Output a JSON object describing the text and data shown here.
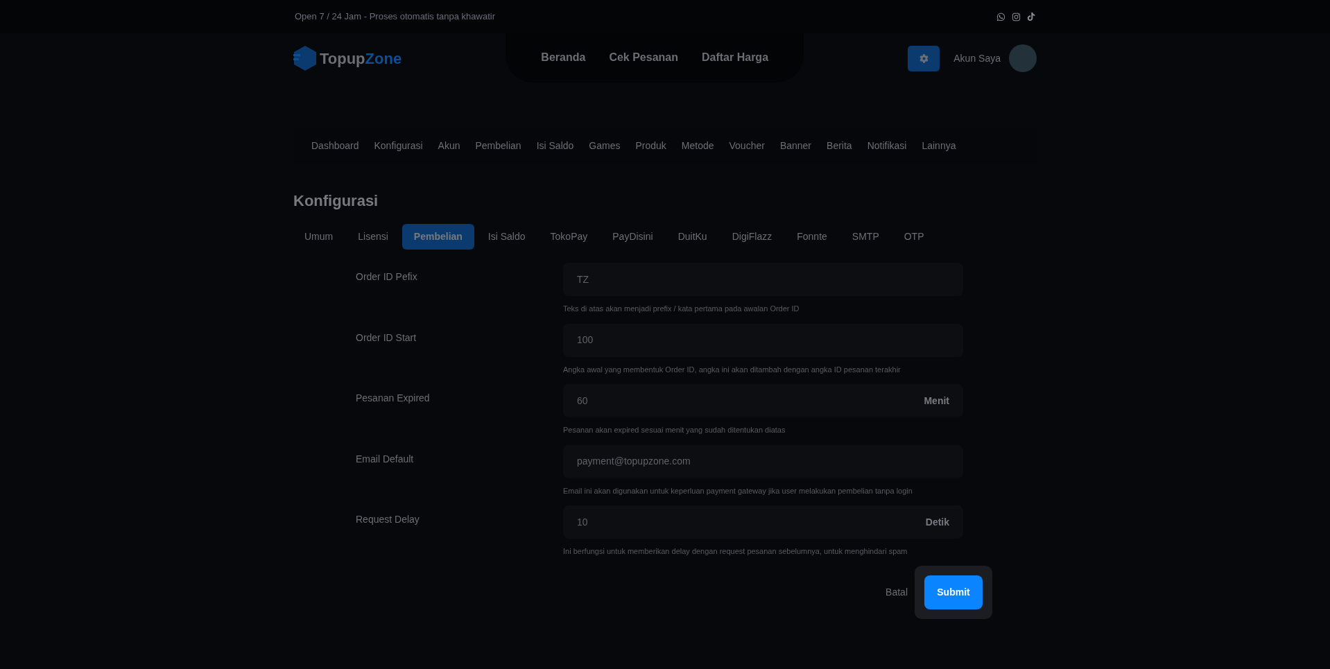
{
  "top_bar": {
    "text": "Open 7 / 24 Jam - Proses otomatis tanpa khawatir"
  },
  "header": {
    "logo": {
      "part_1": "Topup",
      "part_2": "Zone"
    },
    "nav": [
      "Beranda",
      "Cek Pesanan",
      "Daftar Harga"
    ],
    "account_label": "Akun Saya"
  },
  "admin_menu": [
    "Dashboard",
    "Konfigurasi",
    "Akun",
    "Pembelian",
    "Isi Saldo",
    "Games",
    "Produk",
    "Metode",
    "Voucher",
    "Banner",
    "Berita",
    "Notifikasi",
    "Lainnya"
  ],
  "page_title": "Konfigurasi",
  "tabs": [
    {
      "label": "Umum",
      "selected": false
    },
    {
      "label": "Lisensi",
      "selected": false
    },
    {
      "label": "Pembelian",
      "selected": true
    },
    {
      "label": "Isi Saldo",
      "selected": false
    },
    {
      "label": "TokoPay",
      "selected": false
    },
    {
      "label": "PayDisini",
      "selected": false
    },
    {
      "label": "DuitKu",
      "selected": false
    },
    {
      "label": "DigiFlazz",
      "selected": false
    },
    {
      "label": "Fonnte",
      "selected": false
    },
    {
      "label": "SMTP",
      "selected": false
    },
    {
      "label": "OTP",
      "selected": false
    }
  ],
  "fields": [
    {
      "label": "Order ID Pefix",
      "value": "TZ",
      "hint": "Teks di atas akan menjadi prefix / kata pertama pada awalan Order ID"
    },
    {
      "label": "Order ID Start",
      "value": "100",
      "hint": "Angka awal yang membentuk Order ID, angka ini akan ditambah dengan angka ID pesanan terakhir"
    },
    {
      "label": "Pesanan Expired",
      "value": "60",
      "suffix": "Menit",
      "hint": "Pesanan akan expired sesuai menit yang sudah ditentukan diatas"
    },
    {
      "label": "Email Default",
      "value": "payment@topupzone.com",
      "hint": "Email ini akan digunakan untuk keperluan payment gateway jika user melakukan pembelian tanpa login"
    },
    {
      "label": "Request Delay",
      "value": "10",
      "suffix": "Detik",
      "hint": "Ini berfungsi untuk memberikan delay dengan request pesanan sebelumnya, untuk menghindari spam"
    }
  ],
  "actions": {
    "cancel": "Batal",
    "submit": "Submit"
  }
}
